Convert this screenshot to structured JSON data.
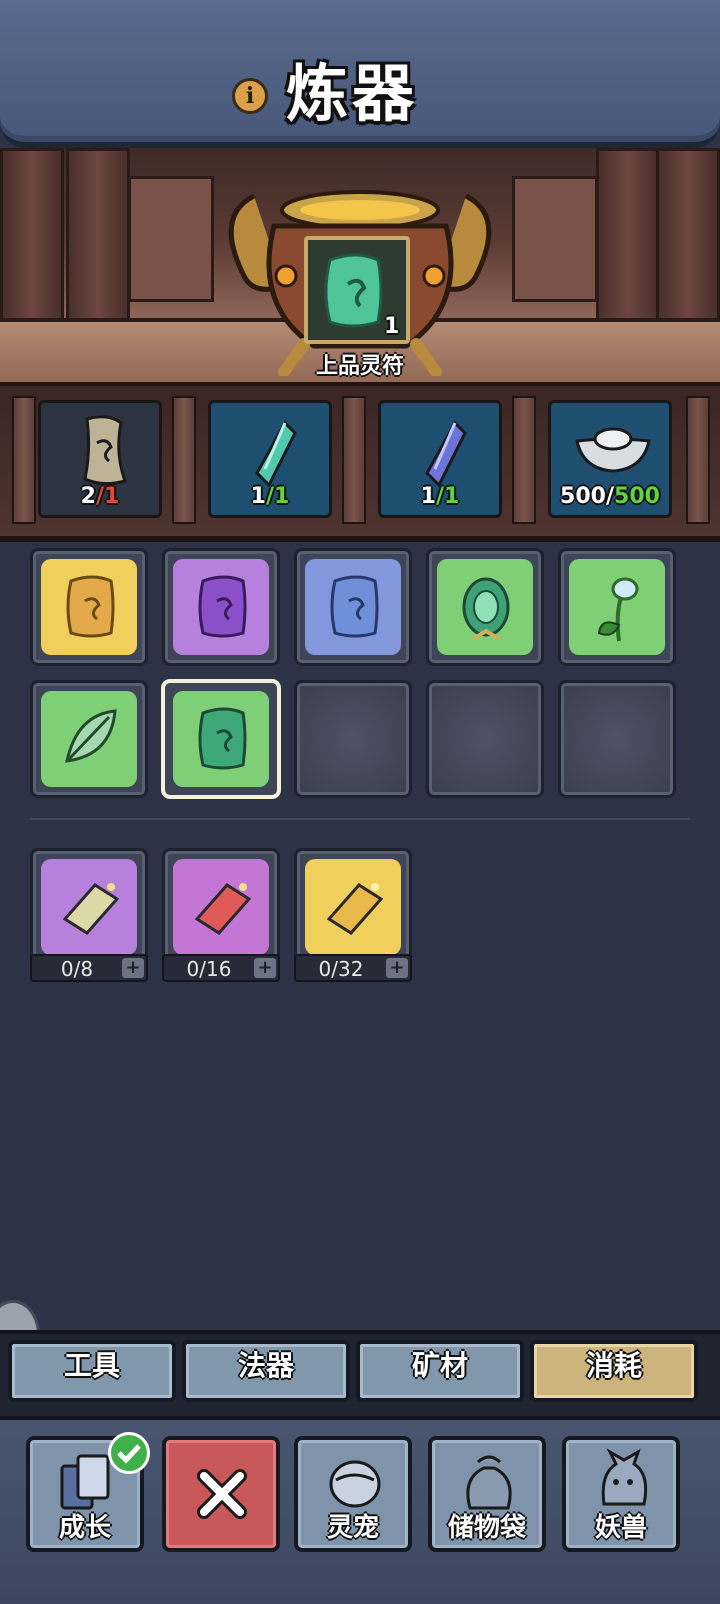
{
  "header": {
    "title": "炼器",
    "info_icon": "info-icon"
  },
  "crafting": {
    "target_name": "上品灵符",
    "target_count": "1",
    "target_icon": "green-talisman-scroll-icon"
  },
  "materials": [
    {
      "icon": "paper-scroll-icon",
      "have": "2",
      "need": "/1",
      "have_color": "#ffffff",
      "need_color": "#e2483a"
    },
    {
      "icon": "green-crystal-icon",
      "have": "1",
      "need": "/1",
      "have_color": "#ffffff",
      "need_color": "#5fd53f"
    },
    {
      "icon": "blue-crystal-icon",
      "have": "1",
      "need": "/1",
      "have_color": "#ffffff",
      "need_color": "#5fd53f"
    },
    {
      "icon": "silver-ingot-icon",
      "have": "500/",
      "need": "500",
      "have_color": "#ffffff",
      "need_color": "#5fd53f"
    }
  ],
  "items": [
    {
      "icon": "yellow-talisman-icon",
      "tile": "yellow"
    },
    {
      "icon": "purple-talisman-icon",
      "tile": "purple"
    },
    {
      "icon": "blue-talisman-icon",
      "tile": "blue"
    },
    {
      "icon": "jade-token-icon",
      "tile": "green"
    },
    {
      "icon": "spirit-herb-icon",
      "tile": "green"
    },
    {
      "icon": "green-leaf-icon",
      "tile": "green"
    },
    {
      "icon": "green-talisman-icon",
      "tile": "green",
      "selected": true
    }
  ],
  "recipes": [
    {
      "icon": "purple-scroll-recipe-icon",
      "stock": "0/8"
    },
    {
      "icon": "red-scroll-recipe-icon",
      "stock": "0/16"
    },
    {
      "icon": "gold-scroll-recipe-icon",
      "stock": "0/32"
    }
  ],
  "tabs": [
    {
      "label": "工具",
      "active": false
    },
    {
      "label": "法器",
      "active": false
    },
    {
      "label": "矿材",
      "active": false
    },
    {
      "label": "消耗",
      "active": true
    }
  ],
  "nav": [
    {
      "label": "成长",
      "icon": "growth-cards-icon"
    },
    {
      "label": "",
      "icon": "close-icon"
    },
    {
      "label": "灵宠",
      "icon": "spirit-pet-icon"
    },
    {
      "label": "储物袋",
      "icon": "storage-bag-icon"
    },
    {
      "label": "妖兽",
      "icon": "demon-beast-icon"
    }
  ],
  "colors": {
    "accent_gold": "#cdb47d",
    "tab_blue": "#8197ab",
    "close_red": "#c9585a",
    "badge_green": "#3fb04a"
  }
}
